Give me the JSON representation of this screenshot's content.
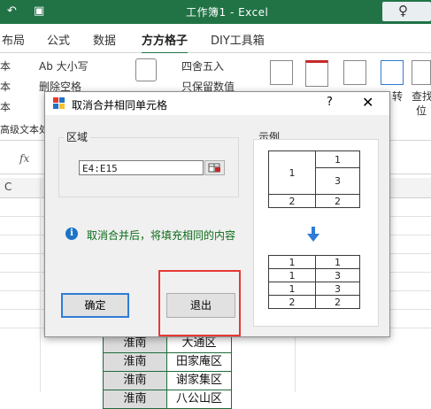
{
  "excel": {
    "title": "工作簿1  -  Excel",
    "search_glyph": "♀",
    "tabs": [
      "布局",
      "公式",
      "数据",
      "方方格子",
      "DIY工具箱"
    ],
    "active_tab": "方方格子",
    "ribbon": {
      "left_items": [
        "本",
        "本",
        "本"
      ],
      "size_item": "Ab 大小写",
      "delete_space": "删除空格",
      "round": "四舍五入",
      "keep_value": "只保留数值",
      "advanced_text": "高级文本处",
      "right_labels": [
        "转",
        "查找",
        "位"
      ]
    },
    "fx_label": "fx",
    "col_header": "C",
    "cells": [
      {
        "left": "淮南",
        "right": "大通区"
      },
      {
        "left": "淮南",
        "right": "田家庵区"
      },
      {
        "left": "淮南",
        "right": "谢家集区"
      },
      {
        "left": "淮南",
        "right": "八公山区"
      }
    ]
  },
  "dialog": {
    "title": "取消合并相同单元格",
    "help": "?",
    "close": "✕",
    "range_label": "区域",
    "range_value": "E4:E15",
    "info_text": "取消合并后，将填充相同的内容",
    "ok_label": "确定",
    "exit_label": "退出",
    "example_label": "示例",
    "example_before": {
      "merged_value": "1",
      "right_top": "1",
      "right_mid": "3",
      "bottom_left": "2",
      "bottom_right": "2"
    },
    "example_after": [
      [
        "1",
        "1"
      ],
      [
        "1",
        "3"
      ],
      [
        "1",
        "3"
      ],
      [
        "2",
        "2"
      ]
    ],
    "colors": {
      "accent": "#217346",
      "info": "#1e73c6",
      "highlight": "#e53935",
      "ok_border": "#2e7cd6"
    }
  }
}
